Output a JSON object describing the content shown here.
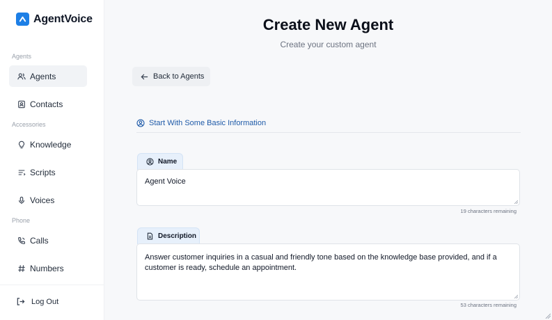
{
  "app": {
    "name": "AgentVoice",
    "brand_color": "#1d7fe6"
  },
  "sidebar": {
    "sections": {
      "agents": "Agents",
      "accessories": "Accessories",
      "phone": "Phone"
    },
    "items": [
      {
        "label": "Agents",
        "icon": "users-icon",
        "active": true
      },
      {
        "label": "Contacts",
        "icon": "contact-card-icon"
      },
      {
        "label": "Knowledge",
        "icon": "lightbulb-icon"
      },
      {
        "label": "Scripts",
        "icon": "text-lines-icon"
      },
      {
        "label": "Voices",
        "icon": "microphone-icon"
      },
      {
        "label": "Calls",
        "icon": "phone-icon"
      },
      {
        "label": "Numbers",
        "icon": "hash-icon"
      }
    ],
    "logout_label": "Log Out"
  },
  "main": {
    "title": "Create New Agent",
    "subtitle": "Create your custom agent",
    "back_label": "Back to Agents",
    "section_heading": "Start With Some Basic Information",
    "name_field": {
      "label": "Name",
      "value": "Agent Voice",
      "remaining": "19 characters remaining"
    },
    "description_field": {
      "label": "Description",
      "value": "Answer customer inquiries in a casual and friendly tone based on the knowledge base provided, and if a customer is ready, schedule an appointment.",
      "remaining": "53 characters remaining"
    }
  }
}
